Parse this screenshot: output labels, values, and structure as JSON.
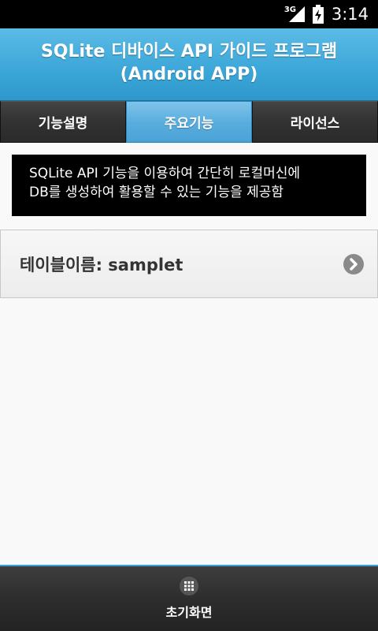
{
  "status_bar": {
    "network_type": "3G",
    "time": "3:14",
    "icons": [
      "signal-icon",
      "battery-icon"
    ]
  },
  "header": {
    "title_line1": "SQLite 디바이스 API 가이드 프로그램",
    "title_line2": "(Android APP)"
  },
  "tabs": [
    {
      "label": "기능설명",
      "active": false
    },
    {
      "label": "주요기능",
      "active": true
    },
    {
      "label": "라이선스",
      "active": false
    }
  ],
  "info": {
    "line1": "SQLite API 기능을 이용하여 간단히 로컬머신에",
    "line2": "DB를 생성하여 활용할 수 있는 기능을 제공함"
  },
  "list": {
    "items": [
      {
        "label": "테이블이름: samplet",
        "icon": "chevron-right-icon"
      }
    ]
  },
  "footer": {
    "home_label": "초기화면",
    "home_icon": "grid-icon"
  },
  "colors": {
    "header_blue": "#3ba6d8",
    "tab_active": "#5aaede",
    "tab_inactive": "#333333",
    "info_bg": "#000000",
    "footer_bg": "#2d2d2d",
    "footer_accent": "#3a9fd6"
  }
}
